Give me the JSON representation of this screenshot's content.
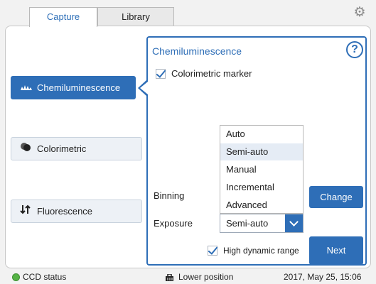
{
  "tabs": [
    {
      "label": "Capture",
      "active": true
    },
    {
      "label": "Library",
      "active": false
    }
  ],
  "settings_icon": "gear-icon",
  "modes": [
    {
      "label": "Chemiluminescence",
      "icon": "chemiluminescence-icon",
      "selected": true
    },
    {
      "label": "Colorimetric",
      "icon": "colorimetric-icon",
      "selected": false
    },
    {
      "label": "Fluorescence",
      "icon": "fluorescence-icon",
      "selected": false
    }
  ],
  "detail": {
    "title": "Chemiluminescence",
    "help_icon": "?",
    "colorimetric_marker": {
      "label": "Colorimetric marker",
      "checked": true
    },
    "binning_label": "Binning",
    "exposure_label": "Exposure",
    "exposure_options": [
      "Auto",
      "Semi-auto",
      "Manual",
      "Incremental",
      "Advanced"
    ],
    "exposure_value": "Semi-auto",
    "change_button": "Change",
    "high_dynamic_range": {
      "label": "High dynamic range",
      "checked": true
    },
    "next_button": "Next"
  },
  "status": {
    "ccd_label": "CCD status",
    "ccd_color": "#56b346",
    "position": "Lower position",
    "datetime": "2017, May 25, 15:06"
  },
  "colors": {
    "accent": "#2e6eb7"
  }
}
